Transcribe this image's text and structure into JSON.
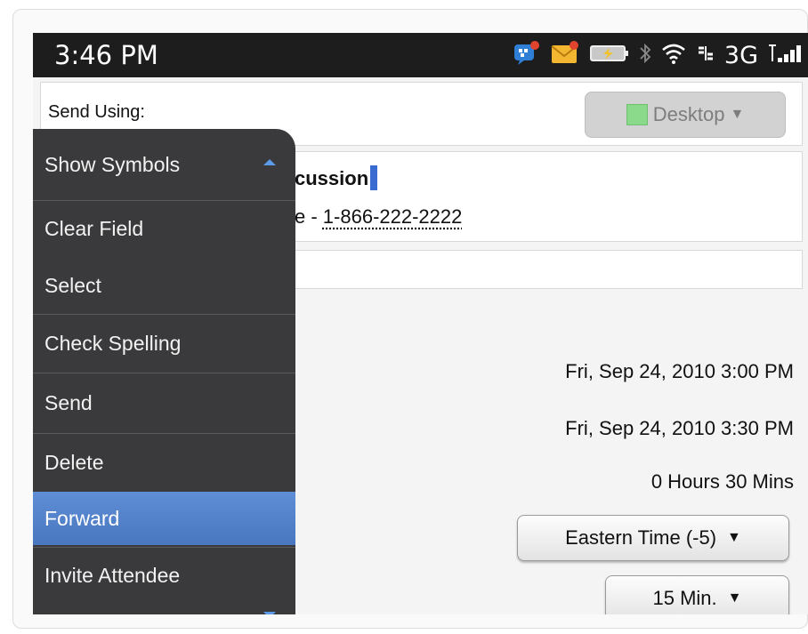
{
  "status_bar": {
    "time": "3:46 PM",
    "network": "3G",
    "icons": [
      "bbm-icon",
      "mail-icon",
      "battery-icon",
      "bluetooth-icon",
      "wifi-icon",
      "network-icon",
      "signal-icon"
    ]
  },
  "send_using": {
    "label": "Send Using:",
    "value": "Desktop"
  },
  "event": {
    "subject_fragment": "cussion",
    "location_prefix": "e - ",
    "phone": "1-866-222-2222"
  },
  "details": {
    "start": "Fri, Sep 24, 2010 3:00 PM",
    "end": "Fri, Sep 24, 2010 3:30 PM",
    "duration": "0 Hours 30 Mins",
    "timezone": "Eastern Time (-5)",
    "reminder": "15 Min."
  },
  "menu": {
    "items": [
      {
        "label": "Show Symbols"
      },
      {
        "label": "Clear Field"
      },
      {
        "label": "Select"
      },
      {
        "label": "Check Spelling"
      },
      {
        "label": "Send"
      },
      {
        "label": "Delete"
      },
      {
        "label": "Forward"
      },
      {
        "label": "Invite Attendee"
      }
    ],
    "selected_index": 6
  },
  "colors": {
    "menu_bg": "#3a3a3c",
    "menu_selected": "#5583cc",
    "status_bar": "#1d1d1d",
    "accent_arrow": "#5b9be8"
  }
}
